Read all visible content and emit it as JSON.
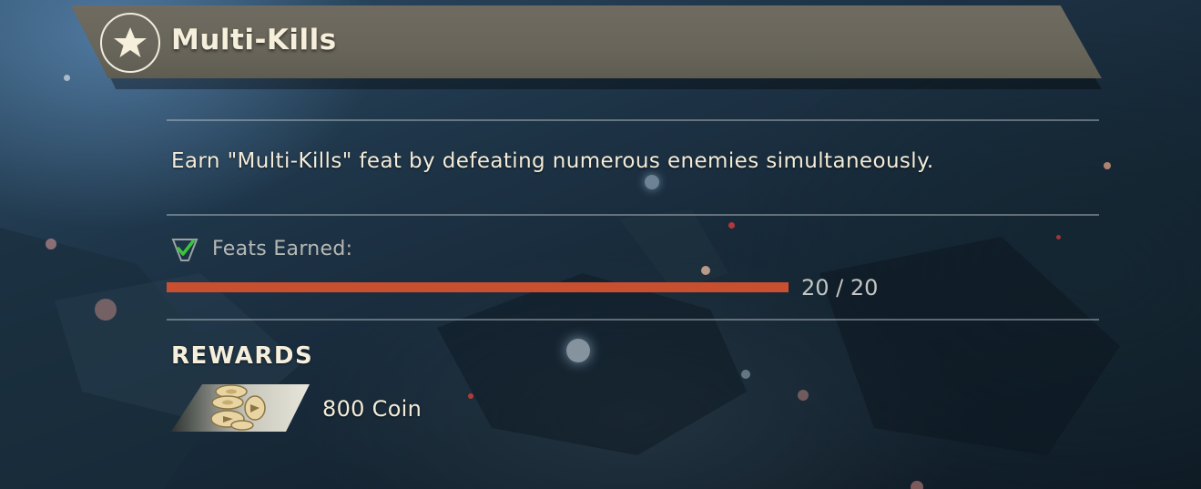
{
  "feat": {
    "title": "Multi-Kills",
    "description": "Earn \"Multi-Kills\" feat by defeating numerous enemies simultaneously."
  },
  "progress": {
    "label": "Feats Earned:",
    "current": 20,
    "total": 20,
    "display": "20 / 20",
    "fraction": 1.0,
    "completed": true
  },
  "rewards": {
    "heading": "REWARDS",
    "items": [
      {
        "label": "800 Coin",
        "icon": "coin-stack-icon"
      }
    ]
  },
  "colors": {
    "banner": "#6a675c",
    "progress_fill": "#c94f31",
    "check": "#3dc43d",
    "text_primary": "#f3ecd9",
    "text_muted": "#b5b8b4"
  },
  "icons": {
    "badge": "star-icon",
    "completed": "checkmark-icon"
  }
}
